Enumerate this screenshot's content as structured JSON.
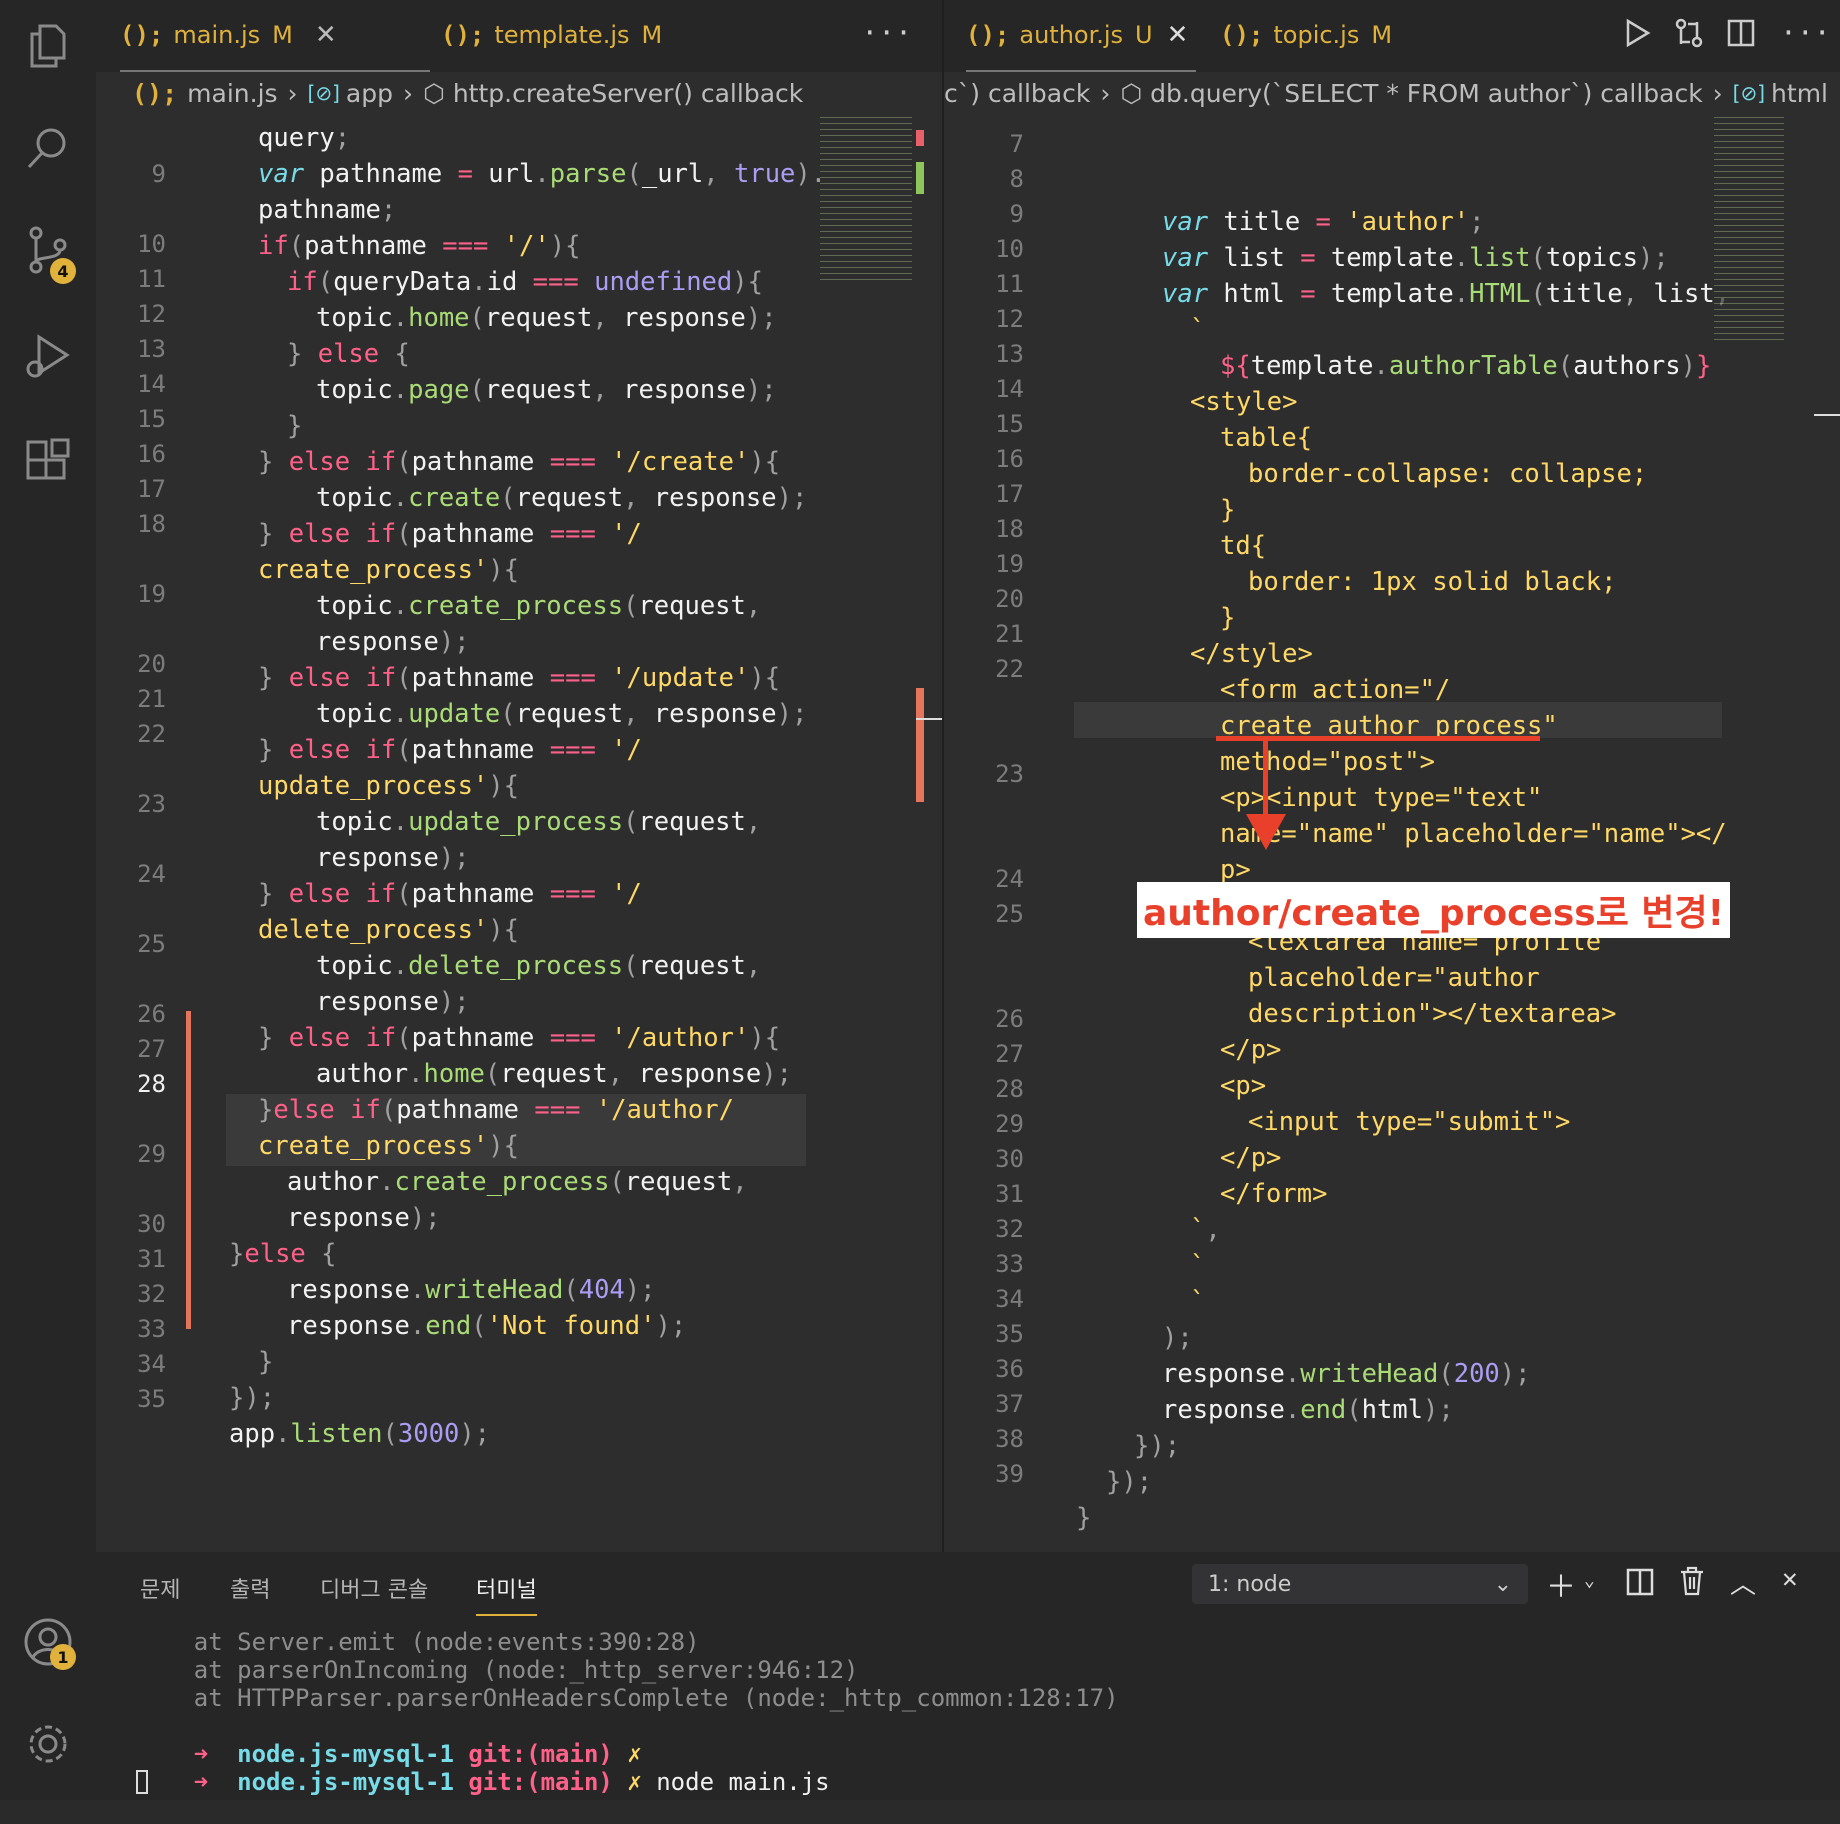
{
  "left_editor": {
    "tabs": [
      {
        "label": "main.js",
        "status": "M",
        "icon": "js-file-icon"
      },
      {
        "label": "template.js",
        "status": "M",
        "icon": "js-file-icon"
      }
    ],
    "more": "···",
    "breadcrumb": {
      "file": "main.js",
      "sym1": "app",
      "sym2": "http.createServer() callback"
    }
  },
  "right_editor": {
    "tabs": [
      {
        "label": "author.js",
        "status": "U",
        "icon": "js-file-icon"
      },
      {
        "label": "topic.js",
        "status": "M",
        "icon": "js-file-icon"
      }
    ],
    "breadcrumb": {
      "part1": "c`) callback",
      "part2": "db.query(`SELECT * FROM author`) callback",
      "part3": "html"
    }
  },
  "annotation": {
    "text": "author/create_process로 변경!",
    "color": "#e8402a"
  },
  "activity_badges": {
    "source_control": "4",
    "accounts": "1"
  },
  "panel": {
    "tabs": [
      "문제",
      "출력",
      "디버그 콘솔",
      "터미널"
    ],
    "active_tab": "터미널",
    "terminal_select": "1: node",
    "lines": [
      "    at Server.emit (node:events:390:28)",
      "    at parserOnIncoming (node:_http_server:946:12)",
      "    at HTTPParser.parserOnHeadersComplete (node:_http_common:128:17)"
    ],
    "prompt1": {
      "arrow": "➜",
      "dir": "node.js-mysql-1",
      "git": "git:(main)",
      "x": "✗",
      "cmd": ""
    },
    "prompt2": {
      "arrow": "➜",
      "dir": "node.js-mysql-1",
      "git": "git:(main)",
      "x": "✗",
      "cmd": "node main.js"
    }
  },
  "colors": {
    "accent": "#e0b23c",
    "annotation": "#e8402a",
    "editor_bg": "#2d2d2e",
    "panel_bg": "#262627"
  }
}
